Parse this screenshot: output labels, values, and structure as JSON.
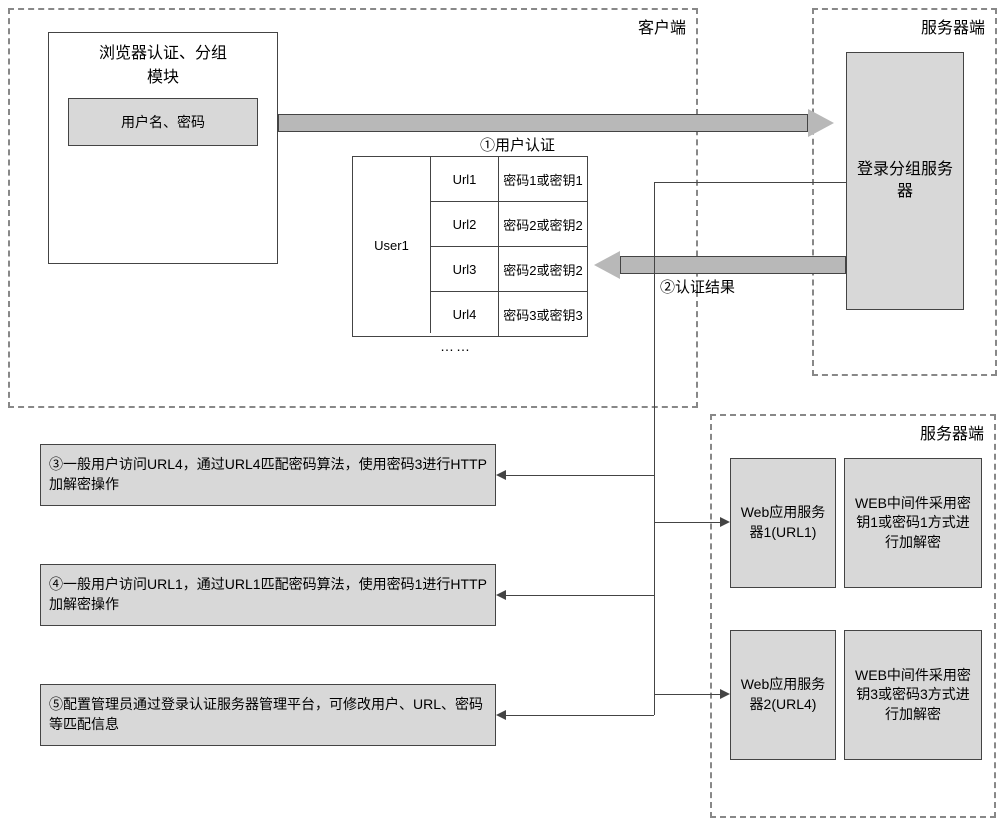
{
  "client": {
    "label": "客户端",
    "auth_module": {
      "title1": "浏览器认证、分组",
      "title2": "模块",
      "creds": "用户名、密码"
    },
    "user_table": {
      "user": "User1",
      "rows": [
        {
          "url": "Url1",
          "key": "密码1或密钥1"
        },
        {
          "url": "Url2",
          "key": "密码2或密钥2"
        },
        {
          "url": "Url3",
          "key": "密码2或密钥2"
        },
        {
          "url": "Url4",
          "key": "密码3或密钥3"
        }
      ],
      "more": "……"
    }
  },
  "server1": {
    "label": "服务器端",
    "login_server": "登录分组服务器"
  },
  "arrows": {
    "a1": "①用户认证",
    "a2": "②认证结果"
  },
  "notes": {
    "n3": "③一般用户访问URL4，通过URL4匹配密码算法，使用密码3进行HTTP加解密操作",
    "n4": "④一般用户访问URL1，通过URL1匹配密码算法，使用密码1进行HTTP加解密操作",
    "n5": "⑤配置管理员通过登录认证服务器管理平台，可修改用户、URL、密码等匹配信息"
  },
  "server2": {
    "label": "服务器端",
    "app1": {
      "name": "Web应用服务器1(URL1)",
      "mw": "WEB中间件采用密钥1或密码1方式进行加解密"
    },
    "app2": {
      "name": "Web应用服务器2(URL4)",
      "mw": "WEB中间件采用密钥3或密码3方式进行加解密"
    }
  }
}
